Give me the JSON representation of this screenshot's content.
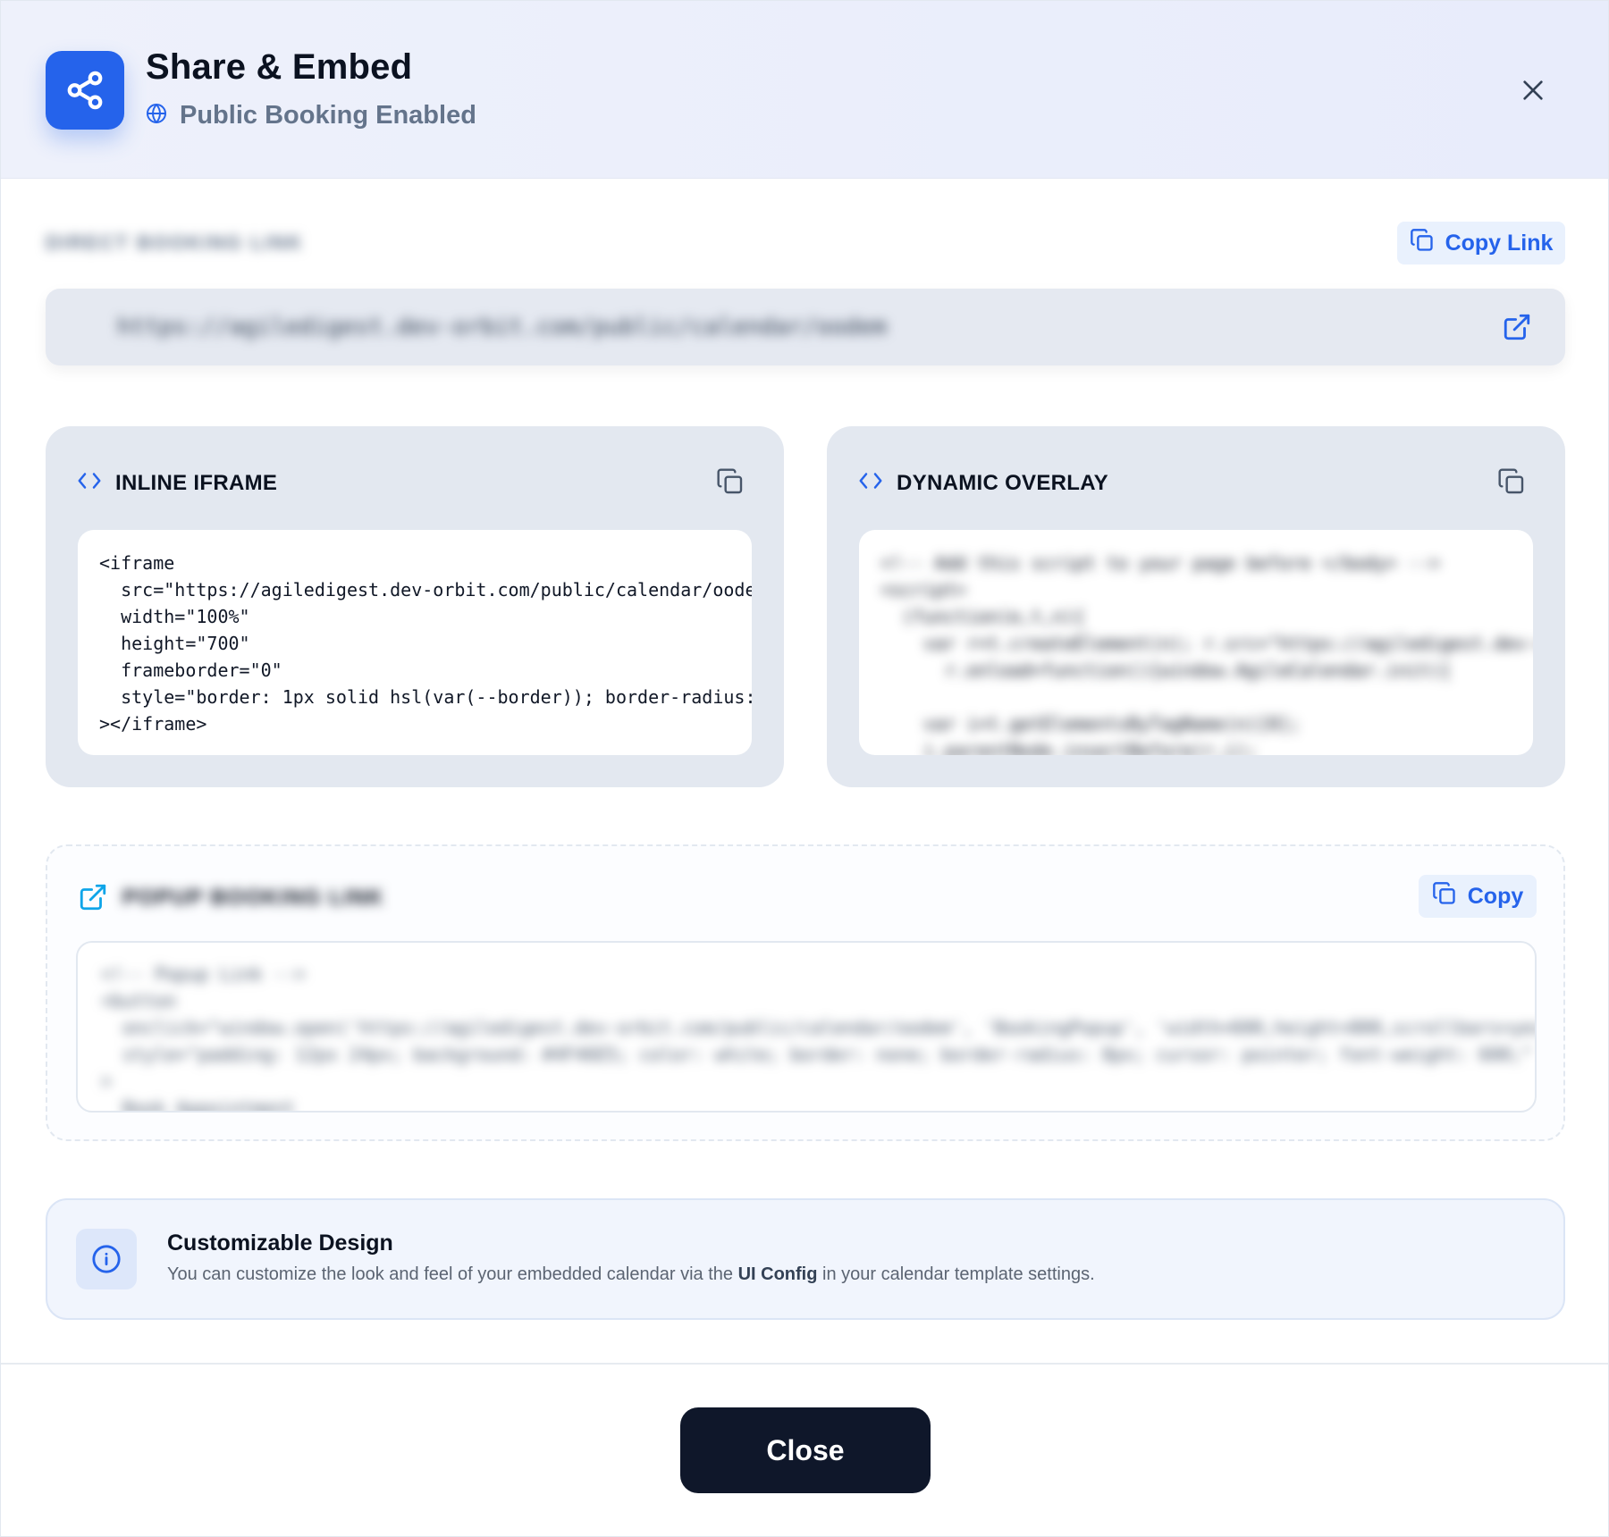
{
  "header": {
    "title": "Share & Embed",
    "subtitle": "Public Booking Enabled",
    "icon": "share-icon",
    "accent": "#2563eb"
  },
  "direct_link": {
    "label": "DIRECT BOOKING LINK",
    "url": "https://agiledigest.dev-orbit.com/public/calendar/oodem",
    "copy_label": "Copy Link"
  },
  "inline_iframe": {
    "title": "INLINE IFRAME",
    "code": "<iframe\n  src=\"https://agiledigest.dev-orbit.com/public/calendar/oode\n  width=\"100%\"\n  height=\"700\"\n  frameborder=\"0\"\n  style=\"border: 1px solid hsl(var(--border)); border-radius:\n></iframe>"
  },
  "dynamic_overlay": {
    "title": "DYNAMIC OVERLAY",
    "code": "<!-- Add this script to your page before </body> -->\n<script>\n  (function(e,t,n){\n    var r=t.createElement(n); r.src=\"https://agiledigest.dev-orbit.com/embe\n      r.onload=function(){window.AgileCalendar.init({\n\n    var i=t.getElementsByTagName(n)[0];\n    i.parentNode.insertBefore(r,i);\n  })(window,document,\"script\");"
  },
  "popup_link": {
    "label": "POPUP BOOKING LINK",
    "copy_label": "Copy",
    "code": "<!-- Popup Link -->\n<button\n  onclick=\"window.open('https://agiledigest.dev-orbit.com/public/calendar/oodem', 'BookingPopup', 'width=600,height=800,scrollbars=yes')\"\n  style=\"padding: 12px 24px; background: #4F46E5; color: white; border: none; border-radius: 8px; cursor: pointer; font-weight: 600;\"\n>\n  Book Appointment\n</button>"
  },
  "info": {
    "title": "Customizable Design",
    "text_before": "You can customize the look and feel of your embedded calendar via the ",
    "text_bold": "UI Config",
    "text_after": " in your calendar template settings."
  },
  "footer": {
    "close_label": "Close"
  }
}
